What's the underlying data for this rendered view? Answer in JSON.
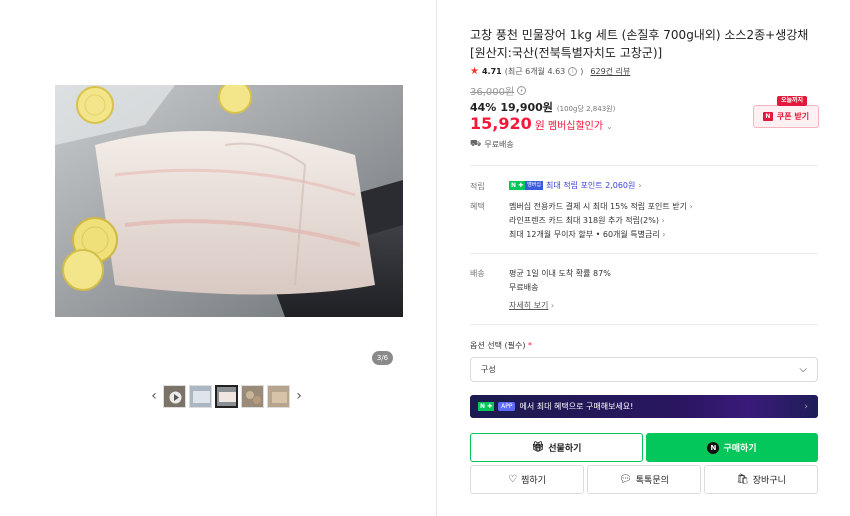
{
  "product": {
    "title": "고창 풍천 민물장어 1kg 세트 (손질후 700g내외) 소스2종+생강채 [원산지:국산(전북특별자치도 고창군)]",
    "rating": "4.71",
    "rating_recent": "(최근 6개월 4.63",
    "rating_recent_close": ")",
    "review_count": "629건 리뷰",
    "original_price": "36,000원",
    "discount_rate": "44%",
    "sale_price": "19,900원",
    "unit_price": "(100g당 2,843원)",
    "member_price": "15,920",
    "member_won": "원",
    "member_label": "멤버십할인가",
    "shipping_short": "무료배송"
  },
  "coupon": {
    "badge": "오늘까지",
    "label": "쿠폰 받기"
  },
  "benefits": {
    "points_label": "적립",
    "points_text": "최대 적립 포인트 2,060원",
    "benefits_label": "혜택",
    "benefit_lines": [
      "멤버십 전용카드 결제 시 최대 15% 적립 포인트 받기",
      "라인프렌즈 카드 최대 318원 추가 적립(2%)",
      "최대 12개월 무이자 할부 • 60개월 특별금리"
    ]
  },
  "delivery": {
    "label": "배송",
    "rate": "평균 1일 이내 도착 확률 87%",
    "fee": "무료배송",
    "detail_link": "자세히 보기"
  },
  "option": {
    "label": "옵션 선택 (필수)",
    "required_mark": "*",
    "selected": "구성"
  },
  "app_banner": {
    "tag": "APP",
    "text": "에서 최대 혜택으로 구매해보세요!"
  },
  "buttons": {
    "gift": "선물하기",
    "buy": "구매하기",
    "wish": "찜하기",
    "talk": "톡톡문의",
    "cart": "장바구니"
  },
  "gallery": {
    "page_indicator": "3/6",
    "thumb_count": 5,
    "active_index": 2
  },
  "colors": {
    "brand_green": "#03c75a",
    "price_red": "#f5183a",
    "point_blue": "#3b3fd8"
  }
}
